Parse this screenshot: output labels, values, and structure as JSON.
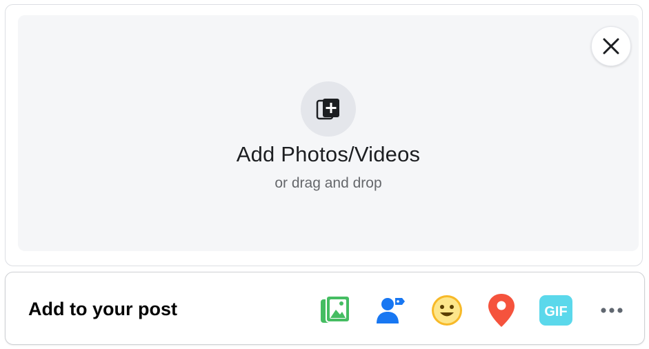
{
  "upload": {
    "title": "Add Photos/Videos",
    "subtitle": "or drag and drop",
    "icon": "add-photos-icon"
  },
  "close": {
    "icon": "close-icon"
  },
  "add_to_post": {
    "label": "Add to your post",
    "tools": [
      {
        "name": "photo-video",
        "icon": "photo-icon",
        "color": "#45bd62"
      },
      {
        "name": "tag-people",
        "icon": "tag-people-icon",
        "color": "#1877f2"
      },
      {
        "name": "feeling-activity",
        "icon": "smiley-icon",
        "color": "#f7b928"
      },
      {
        "name": "check-in",
        "icon": "location-pin-icon",
        "color": "#f5533d"
      },
      {
        "name": "gif",
        "icon": "gif-icon",
        "label": "GIF",
        "color": "#3ed1e8"
      },
      {
        "name": "more",
        "icon": "more-icon",
        "color": "#606770"
      }
    ]
  }
}
